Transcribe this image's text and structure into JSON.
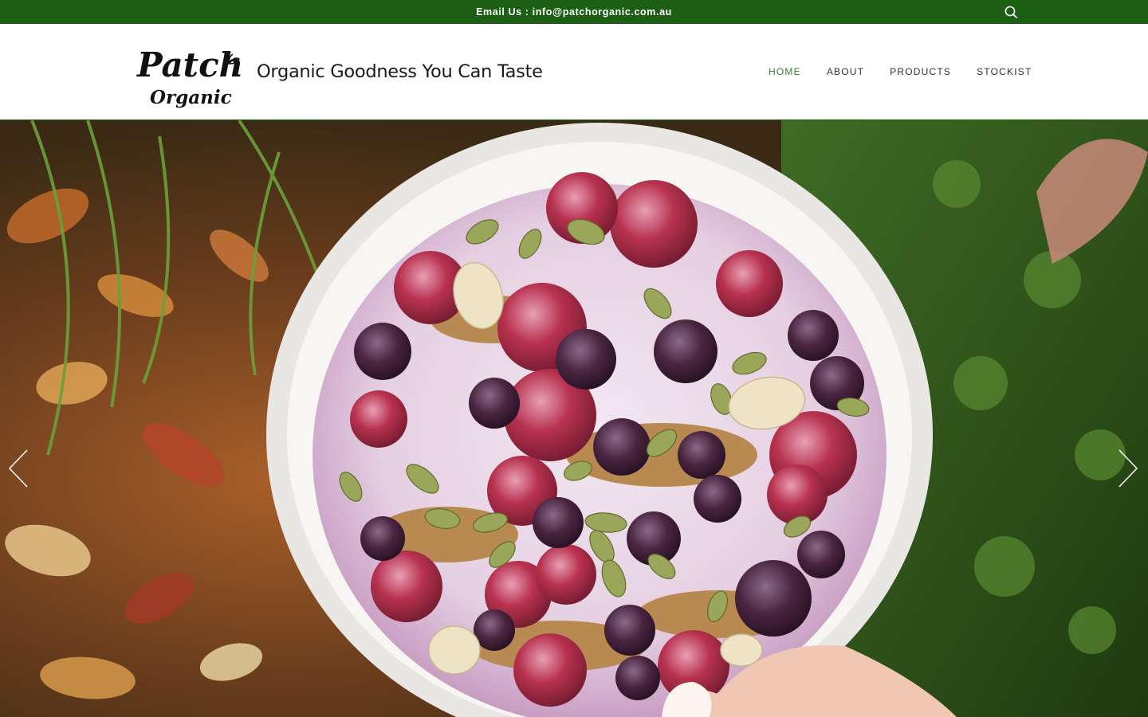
{
  "topbar": {
    "email_text": "Email Us : info@patchorganic.com.au",
    "search_icon": "search-icon"
  },
  "header": {
    "logo_line1": "Patch",
    "logo_line2": "Organic",
    "tagline": "Organic Goodness You Can Taste"
  },
  "nav": {
    "items": [
      {
        "label": "HOME",
        "active": true
      },
      {
        "label": "ABOUT",
        "active": false
      },
      {
        "label": "PRODUCTS",
        "active": false
      },
      {
        "label": "STOCKIST",
        "active": false
      }
    ]
  },
  "hero": {
    "image": "breakfast-bowl-photo",
    "prev_icon": "chevron-left-icon",
    "next_icon": "chevron-right-icon"
  },
  "colors": {
    "brand_green": "#1b5e14",
    "nav_active": "#3b7a3b",
    "nav_text": "#333333"
  }
}
